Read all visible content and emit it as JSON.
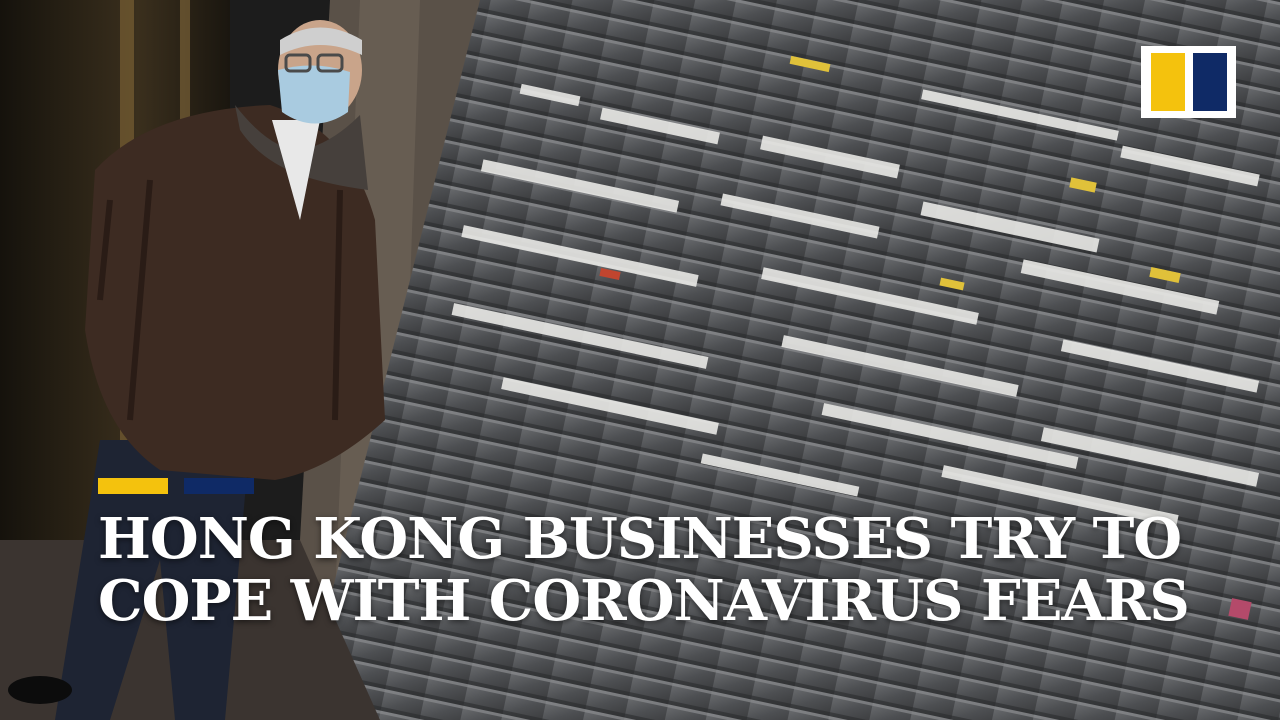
{
  "headline": {
    "line1": "HONG KONG BUSINESSES TRY TO",
    "line2": "COPE WITH CORONAVIRUS FEARS"
  },
  "colors": {
    "accent_yellow": "#f4c20d",
    "accent_navy": "#0f2a66",
    "logo_yellow": "#f4c20d",
    "logo_navy": "#0f2a66"
  },
  "logo": {
    "icon": "scmp-logo-icon"
  }
}
